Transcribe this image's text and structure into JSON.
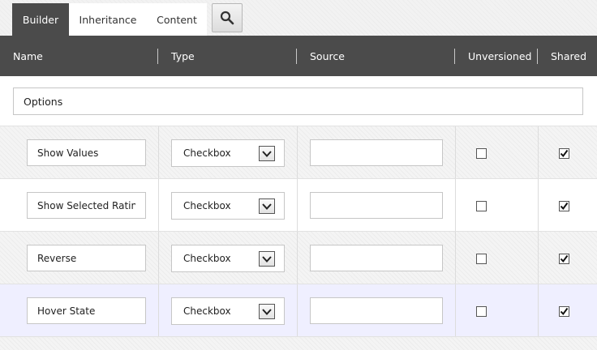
{
  "tabs": [
    {
      "label": "Builder",
      "active": true
    },
    {
      "label": "Inheritance",
      "active": false
    },
    {
      "label": "Content",
      "active": false
    }
  ],
  "search_icon": "magnifier-icon",
  "columns": {
    "name": "Name",
    "type": "Type",
    "source": "Source",
    "unversioned": "Unversioned",
    "shared": "Shared"
  },
  "section": {
    "value": "Options"
  },
  "fields": [
    {
      "name": "Show Values",
      "type": "Checkbox",
      "source": "",
      "unversioned": false,
      "shared": true
    },
    {
      "name": "Show Selected Rating",
      "type": "Checkbox",
      "source": "",
      "unversioned": false,
      "shared": true
    },
    {
      "name": "Reverse",
      "type": "Checkbox",
      "source": "",
      "unversioned": false,
      "shared": true
    },
    {
      "name": "Hover State",
      "type": "Checkbox",
      "source": "",
      "unversioned": false,
      "shared": true
    }
  ],
  "colors": {
    "header_bg": "#4b4b4b",
    "hover_row": "#efefff"
  }
}
